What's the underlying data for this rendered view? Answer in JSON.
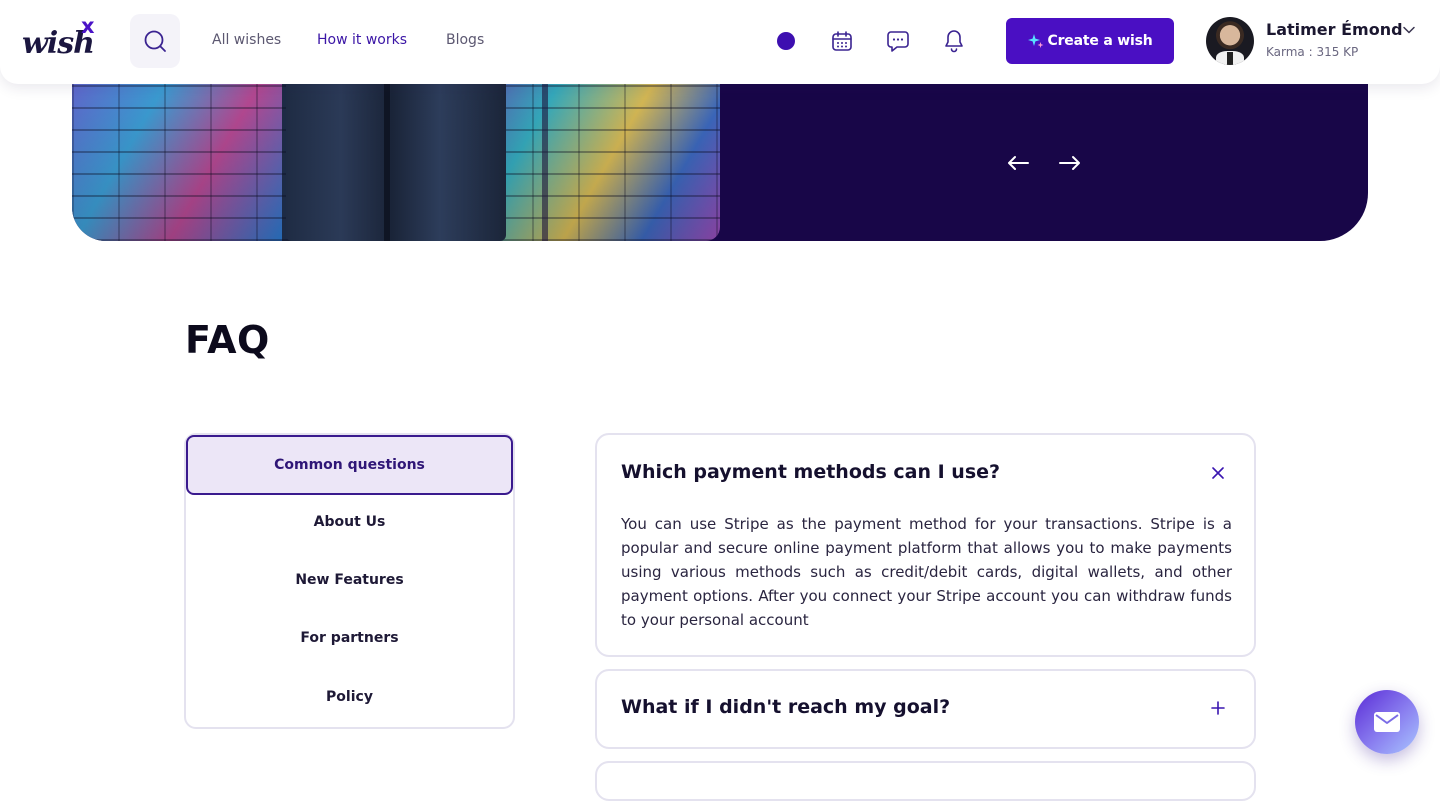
{
  "brand": {
    "logo_text": "wish",
    "logo_mark": "x",
    "primary_color": "#4a0fc3",
    "dark_color": "#180648"
  },
  "header": {
    "search_icon": "search-icon",
    "nav": [
      {
        "label": "All wishes",
        "active": false
      },
      {
        "label": "How it works",
        "active": true
      },
      {
        "label": "Blogs",
        "active": false
      }
    ],
    "icons": [
      "status-dot",
      "calendar-icon",
      "chat-bubble-icon",
      "bell-icon"
    ],
    "create_button": {
      "label": "Create a wish",
      "icon": "sparkle-icon"
    },
    "user": {
      "name": "Latimer Émond",
      "karma": "Karma : 315 KP"
    }
  },
  "hero": {
    "prev_icon": "arrow-left-icon",
    "next_icon": "arrow-right-icon"
  },
  "faq": {
    "title": "FAQ",
    "categories": [
      {
        "label": "Common questions",
        "active": true
      },
      {
        "label": "About Us",
        "active": false
      },
      {
        "label": "New Features",
        "active": false
      },
      {
        "label": "For partners",
        "active": false
      },
      {
        "label": "Policy",
        "active": false
      }
    ],
    "items": [
      {
        "question": "Which payment methods can I use?",
        "expanded": true,
        "answer": "You can use Stripe as the payment method for your transactions. Stripe is a popular and secure online payment platform that allows you to make payments using various methods such as credit/debit cards, digital wallets, and other payment options. After you connect your Stripe account you can withdraw funds to your personal account"
      },
      {
        "question": "What if I didn't reach my goal?",
        "expanded": false,
        "answer": ""
      }
    ]
  },
  "chat_widget": {
    "icon": "mail-icon"
  }
}
